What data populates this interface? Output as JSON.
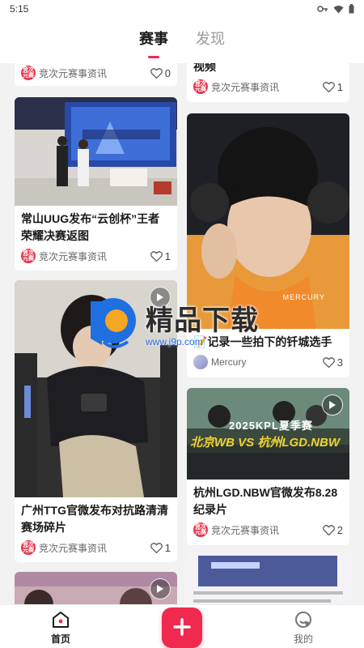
{
  "status_bar": {
    "time": "5:15",
    "icons": [
      "key-icon",
      "wifi-icon",
      "battery-icon"
    ]
  },
  "top_tabs": [
    {
      "label": "赛事",
      "active": true
    },
    {
      "label": "发现",
      "active": false
    }
  ],
  "avatar_text": "竞次\n元赛",
  "feed": {
    "left": [
      {
        "title": "",
        "author": "竞次元赛事资讯",
        "likes": "0",
        "video": false
      },
      {
        "title": "常山UUG发布“云创杯”王者荣耀决赛返图",
        "author": "竞次元赛事资讯",
        "likes": "1",
        "video": false
      },
      {
        "title": "广州TTG官微发布对抗路清清赛场碎片",
        "author": "竞次元赛事资讯",
        "likes": "1",
        "video": true
      },
      {
        "title": "",
        "author": "",
        "likes": "",
        "video": true
      }
    ],
    "right": [
      {
        "title": "视频",
        "author": "竞次元赛事资讯",
        "likes": "1",
        "video": false
      },
      {
        "title": "📝记录一些拍下的钎城选手",
        "author": "Mercury",
        "likes": "3",
        "video": false,
        "image_caption": "MERCURY"
      },
      {
        "title": "杭州LGD.NBW官微发布8.28纪录片",
        "author": "竞次元赛事资讯",
        "likes": "2",
        "video": true,
        "image_caption": "2025KPL夏季赛",
        "image_caption2": "北京WB VS 杭州LGD.NBW"
      },
      {
        "title": "",
        "author": "",
        "likes": "",
        "video": false,
        "image_caption": "",
        "image_caption2": ""
      }
    ]
  },
  "watermark": {
    "title": "精品下载",
    "url": "www.j9p.com"
  },
  "bottom_nav": [
    {
      "label": "首页",
      "icon": "home-icon",
      "active": true
    },
    {
      "label": "",
      "icon": "plus-icon",
      "active": false
    },
    {
      "label": "我的",
      "icon": "profile-icon",
      "active": false
    }
  ],
  "colors": {
    "accent": "#f0294f",
    "card_bg": "#ffffff",
    "page_bg": "#f2f2f2"
  }
}
